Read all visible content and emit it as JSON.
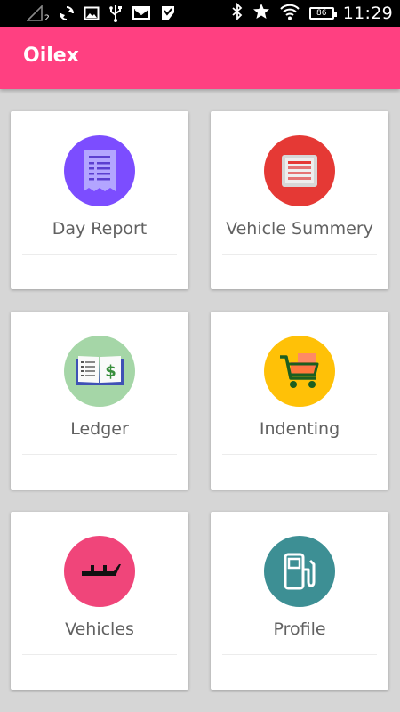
{
  "status_bar": {
    "signal_sub": "2",
    "battery": "86",
    "time": "11:29"
  },
  "app_bar": {
    "title": "Oilex"
  },
  "colors": {
    "app_bar": "#ff4081",
    "day_report": "#7c4dff",
    "vehicle_summery": "#e53935",
    "ledger": "#a5d6a7",
    "indenting": "#ffc107",
    "vehicles": "#f0457a",
    "profile": "#3d8f94"
  },
  "menu": [
    {
      "label": "Day Report",
      "icon": "report-document-icon"
    },
    {
      "label": "Vehicle Summery",
      "icon": "summary-list-icon"
    },
    {
      "label": "Ledger",
      "icon": "ledger-book-icon"
    },
    {
      "label": "Indenting",
      "icon": "shopping-cart-icon"
    },
    {
      "label": "Vehicles",
      "icon": "vehicle-icon"
    },
    {
      "label": "Profile",
      "icon": "fuel-pump-icon"
    }
  ]
}
